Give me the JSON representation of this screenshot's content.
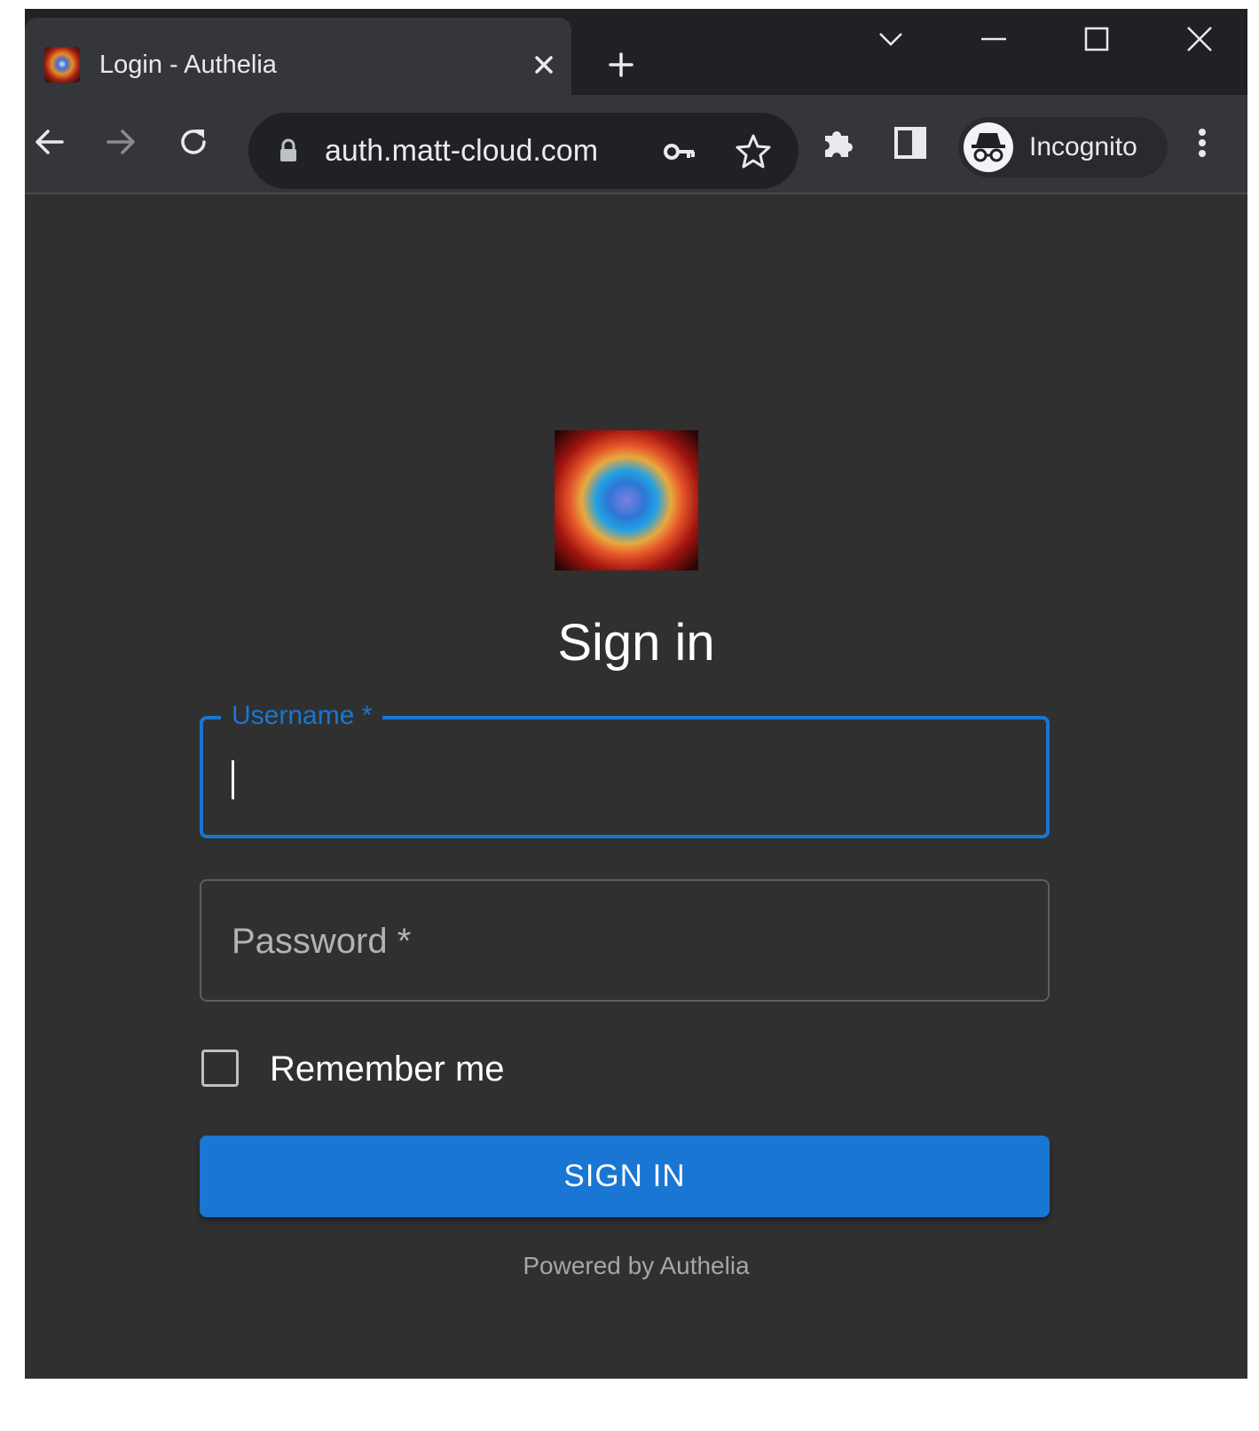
{
  "browser": {
    "tab_title": "Login - Authelia",
    "url": "auth.matt-cloud.com",
    "profile_label": "Incognito",
    "icons": [
      "favicon-icon",
      "close-icon",
      "plus-icon",
      "chevron-down-icon",
      "minimize-icon",
      "maximize-icon",
      "window-close-icon",
      "back-arrow-icon",
      "forward-arrow-icon",
      "reload-icon",
      "lock-icon",
      "key-icon",
      "star-icon",
      "puzzle-icon",
      "side-panel-icon",
      "incognito-icon",
      "kebab-menu-icon"
    ]
  },
  "page": {
    "heading": "Sign in",
    "username_label": "Username *",
    "username_value": "",
    "password_label": "Password *",
    "remember_label": "Remember me",
    "remember_checked": false,
    "submit_label": "SIGN IN",
    "footer": "Powered by Authelia"
  },
  "colors": {
    "accent": "#1976d2",
    "background": "#303030",
    "toolbar": "#35363a",
    "tabstrip": "#202124"
  }
}
